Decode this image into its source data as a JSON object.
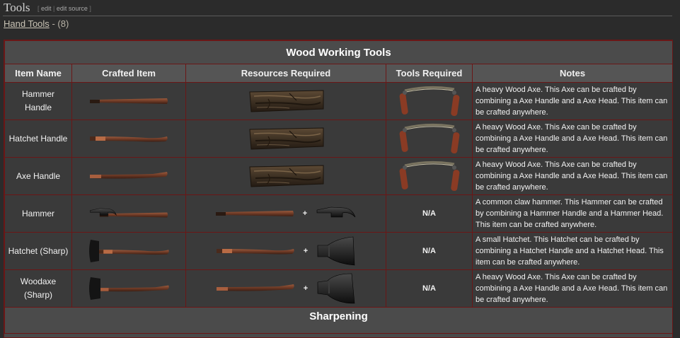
{
  "section": {
    "title": "Tools",
    "edit": "edit",
    "edit_source": "edit source"
  },
  "subheading": {
    "link": "Hand Tools",
    "count": "(8)"
  },
  "table": {
    "title": "Wood Working Tools",
    "columns": [
      "Item Name",
      "Crafted Item",
      "Resources Required",
      "Tools Required",
      "Notes"
    ],
    "rows": [
      {
        "name": "Hammer Handle",
        "tools": "",
        "notes": "A heavy Wood Axe. This Axe can be crafted by combining a Axe Handle and a Axe Head. This item can be crafted anywhere."
      },
      {
        "name": "Hatchet Handle",
        "tools": "",
        "notes": "A heavy Wood Axe. This Axe can be crafted by combining a Axe Handle and a Axe Head. This item can be crafted anywhere."
      },
      {
        "name": "Axe Handle",
        "tools": "",
        "notes": "A heavy Wood Axe. This Axe can be crafted by combining a Axe Handle and a Axe Head. This item can be crafted anywhere."
      },
      {
        "name": "Hammer",
        "tools": "N/A",
        "notes": "A common claw hammer. This Hammer can be crafted by combining a Hammer Handle and a Hammer Head. This item can be crafted anywhere."
      },
      {
        "name": "Hatchet (Sharp)",
        "tools": "N/A",
        "notes": "A small Hatchet. This Hatchet can be crafted by combining a Hatchet Handle and a Hatchet Head. This item can be crafted anywhere."
      },
      {
        "name": "Woodaxe (Sharp)",
        "tools": "N/A",
        "notes": "A heavy Wood Axe. This Axe can be crafted by combining a Axe Handle and a Axe Head. This item can be crafted anywhere."
      }
    ],
    "plus": "+",
    "next_section": "Sharpening"
  }
}
